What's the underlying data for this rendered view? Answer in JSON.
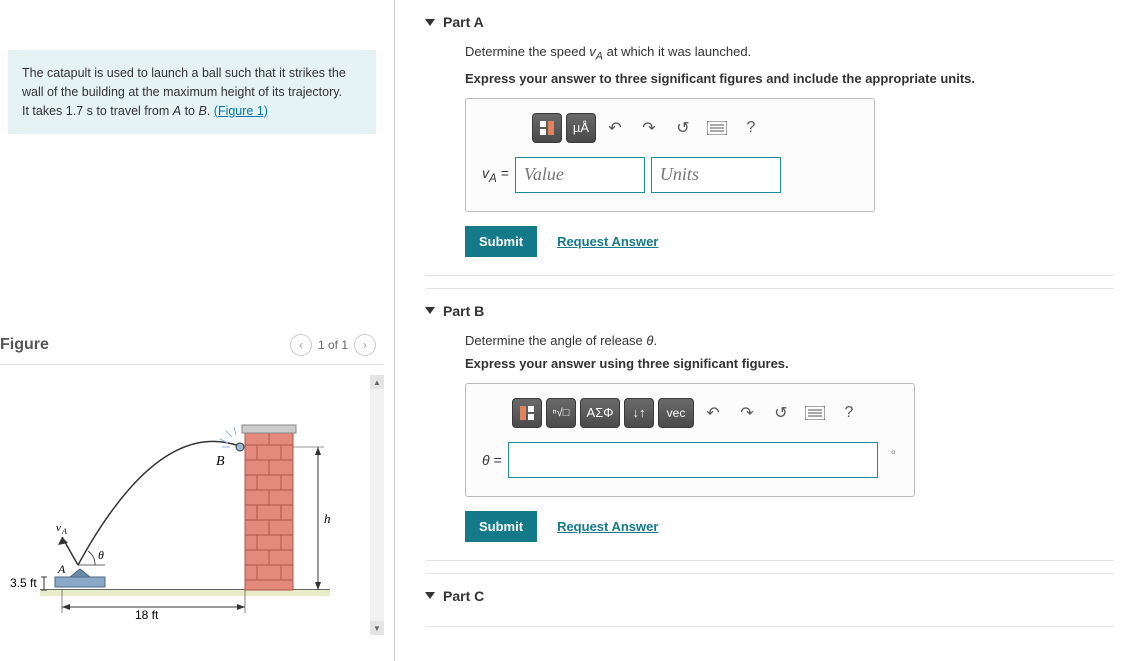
{
  "problem": {
    "text_line1": "The catapult is used to launch a ball such that it strikes the",
    "text_line2": "wall of the building at the maximum height of its trajectory.",
    "text_line3_prefix": "It takes 1.7  s to travel from ",
    "text_line3_A": "A",
    "text_line3_mid": " to ",
    "text_line3_B": "B",
    "text_line3_suffix": ". ",
    "figure_link": "(Figure 1)"
  },
  "figure_panel": {
    "title": "Figure",
    "nav_text": "1 of 1",
    "labels": {
      "B": "B",
      "vA": "vA",
      "A": "A",
      "theta": "θ",
      "height_base": "3.5 ft",
      "width": "18 ft",
      "h": "h"
    }
  },
  "parts": {
    "A": {
      "title": "Part A",
      "prompt_prefix": "Determine the speed ",
      "prompt_var": "v",
      "prompt_sub": "A",
      "prompt_suffix": " at which it was launched.",
      "instruction": "Express your answer to three significant figures and include the appropriate units.",
      "toolbar": {
        "units_btn": "µÅ"
      },
      "var_label": "vA =",
      "value_placeholder": "Value",
      "units_placeholder": "Units",
      "submit": "Submit",
      "request": "Request Answer"
    },
    "B": {
      "title": "Part B",
      "prompt_prefix": "Determine the angle of release ",
      "prompt_var": "θ",
      "prompt_suffix": ".",
      "instruction": "Express your answer using three significant figures.",
      "toolbar": {
        "greek_btn": "ΑΣΦ",
        "vec_btn": "vec",
        "arrows_btn": "↓↑"
      },
      "var_label": "θ =",
      "degree": "∘",
      "submit": "Submit",
      "request": "Request Answer"
    },
    "C": {
      "title": "Part C"
    }
  },
  "icons": {
    "help": "?",
    "undo": "↶",
    "redo": "↷",
    "reset": "↺"
  }
}
